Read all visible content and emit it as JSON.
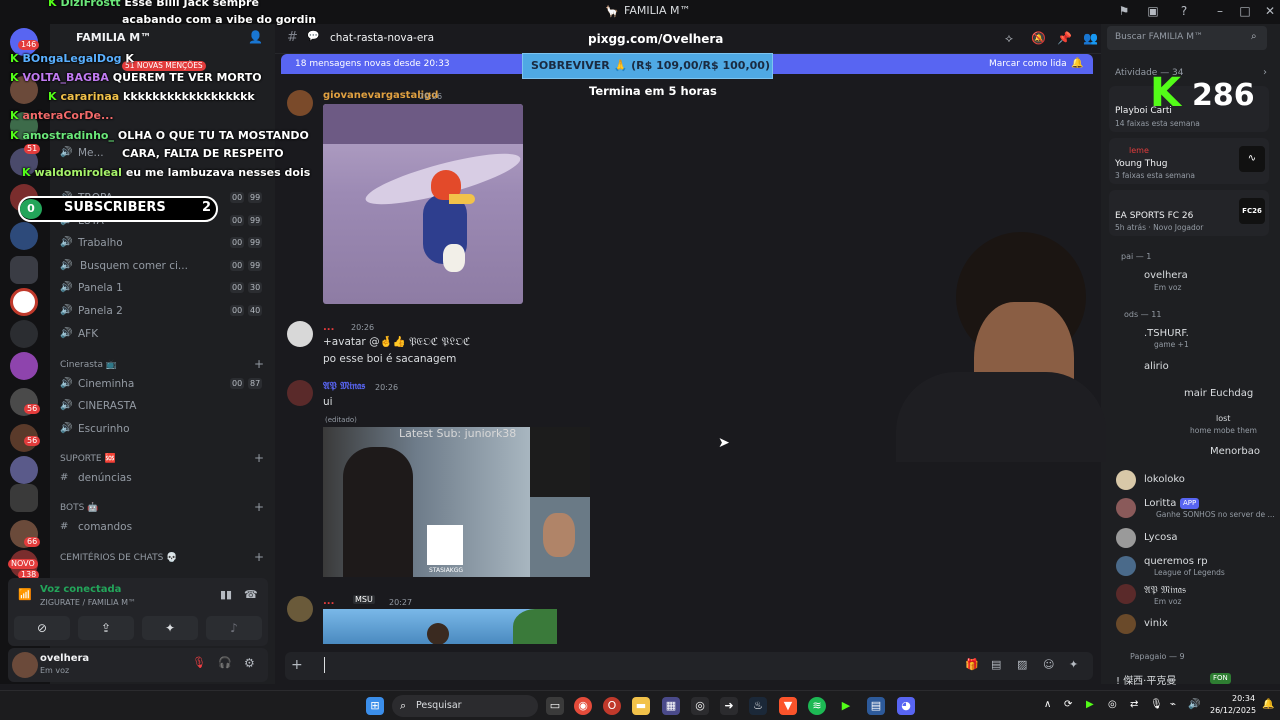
{
  "window": {
    "title": "FAMILIA M™"
  },
  "overlay": {
    "chat": [
      {
        "user": "DiziFrostt",
        "text": "Esse Billi Jack sempre"
      },
      {
        "user": "",
        "text": "acabando com a vibe do gordin"
      },
      {
        "user": "BOngaLegalDog",
        "text": "K"
      },
      {
        "user": "VOLTA_BAGBA",
        "text": "QUEREM TE VER MORTO"
      },
      {
        "user": "cararinaa",
        "text": "kkkkkkkkkkkkkkkkkk"
      },
      {
        "user": "anteraCorDe...",
        "text": ""
      },
      {
        "user": "amostradinho_",
        "text": "OLHA O QUE TU TA MOSTANDO"
      },
      {
        "user": "",
        "text": "CARA, FALTA DE RESPEITO"
      },
      {
        "user": "waldomiroleal",
        "text": "eu me lambuzava nesses dois"
      }
    ],
    "subscribers": {
      "left": "0",
      "label": "SUBSCRIBERS",
      "right": "2"
    },
    "pix": {
      "url": "pixgg.com/Ovelhera",
      "goal": "SOBREVIVER 🙏 (R$ 109,00/R$ 100,00)",
      "ends": "Termina em 5 horas"
    },
    "viewers": "286"
  },
  "server": {
    "name": "FAMILIA M™",
    "mentions": "51 NOVAS MENÇÕES"
  },
  "rail_badges": [
    "146",
    "51",
    "56",
    "56",
    "66",
    "NOVO",
    "138"
  ],
  "channels": [
    {
      "name": "Me...",
      "count": "",
      "count2": ""
    },
    {
      "name": "TROPA",
      "count": "00",
      "count2": "99"
    },
    {
      "name": "LUTA",
      "count": "00",
      "count2": "99"
    },
    {
      "name": "Trabalho",
      "count": "00",
      "count2": "99"
    },
    {
      "name": "Busquem comer ci...",
      "count": "00",
      "count2": "99"
    },
    {
      "name": "Panela 1",
      "count": "00",
      "count2": "30"
    },
    {
      "name": "Panela 2",
      "count": "00",
      "count2": "40"
    },
    {
      "name": "AFK",
      "count": "",
      "count2": ""
    }
  ],
  "categories": {
    "cinerasta": "Cinerasta 📺",
    "suporte": "SUPORTE 🆘",
    "bots": "BOTS 🤖",
    "cemiterios": "CEMITÉRIOS DE CHATS 💀"
  },
  "cinerasta_channels": [
    {
      "name": "Cineminha",
      "count": "00",
      "count2": "87"
    },
    {
      "name": "CINERASTA",
      "count": "",
      "count2": ""
    },
    {
      "name": "Escurinho",
      "count": "",
      "count2": ""
    }
  ],
  "text_channels": {
    "denuncias": "denúncias",
    "comandos": "comandos"
  },
  "voice": {
    "status": "Voz conectada",
    "where": "ZIGURATE / FAMILIA M™"
  },
  "user": {
    "name": "ovelhera",
    "status": "Em voz"
  },
  "chat": {
    "channel": "chat-rasta-nova-era",
    "new_messages": "18 mensagens novas desde 20:33",
    "mark_read": "Marcar como lida",
    "messages": [
      {
        "author": "giovanevargastaligd",
        "time": "20:26",
        "text": "",
        "color": "#e0a040"
      },
      {
        "author": "...",
        "time": "20:26",
        "text": "+avatar @🤞👍 𝔓𝔈𝔒ℭ 𝔓𝔏𝔒ℭ",
        "text2": "po esse boi é sacanagem",
        "color": "#e33c3c"
      },
      {
        "author": "𝔄𝔓 𝔐𝔦𝔫𝔞𝔰",
        "time": "20:26",
        "text": "ui",
        "edited": "(editado)",
        "color": "#5865f2"
      },
      {
        "author": "...",
        "tag": "MSU",
        "time": "20:27",
        "text": "",
        "color": "#e33c3c"
      }
    ],
    "embedded_overlay": "Latest Sub: juniork38",
    "embedded_name": "STASIAKGG",
    "search_placeholder": "Buscar FAMILIA M™"
  },
  "members": {
    "activity_header": "Atividade — 34",
    "activities": [
      {
        "name": "Playboi Carti",
        "sub": "14 faixas esta semana"
      },
      {
        "name": "Young Thug",
        "sub": "3 faixas esta semana",
        "label": "leme"
      },
      {
        "name": "EA SPORTS FC 26",
        "sub": "5h atrás · Novo Jogador",
        "badge": "FC26"
      }
    ],
    "group1": "pai — 1",
    "group2": "ods — 11",
    "list": [
      {
        "name": "ovelhera",
        "sub": "Em voz",
        "color": "#e74c3c"
      },
      {
        "name": ".TSHURF.",
        "sub": "game +1",
        "color": "#e0c040"
      },
      {
        "name": "alirio",
        "sub": "",
        "color": "#e0c040"
      },
      {
        "name": "mair Euchdag",
        "sub": "",
        "color": "#5865f2"
      },
      {
        "name": "lost",
        "sub": "home mobe them",
        "color": "#b07cf0"
      },
      {
        "name": "Menorbao",
        "sub": "",
        "color": "#e0c040"
      },
      {
        "name": "lokoloko",
        "sub": "",
        "color": "#e0c040"
      },
      {
        "name": "Loritta",
        "sub": "Ganhe SONHOS no server de ...",
        "color": "#5865f2",
        "tag": "APP"
      },
      {
        "name": "Lycosa",
        "sub": "",
        "color": "#dbdee1"
      },
      {
        "name": "queremos rp",
        "sub": "League of Legends",
        "color": "#5865f2"
      },
      {
        "name": "𝔄𝔓 𝔐𝔦𝔫𝔞𝔰",
        "sub": "Em voz",
        "color": "#5865f2"
      },
      {
        "name": "vinix",
        "sub": "",
        "color": "#e0c040"
      }
    ],
    "group3": "Papagaio — 9",
    "last": {
      "name": "! 傑西·平克曼",
      "tag": "FON"
    }
  },
  "taskbar": {
    "search": "Pesquisar",
    "time": "20:34",
    "date": "26/12/2025"
  }
}
